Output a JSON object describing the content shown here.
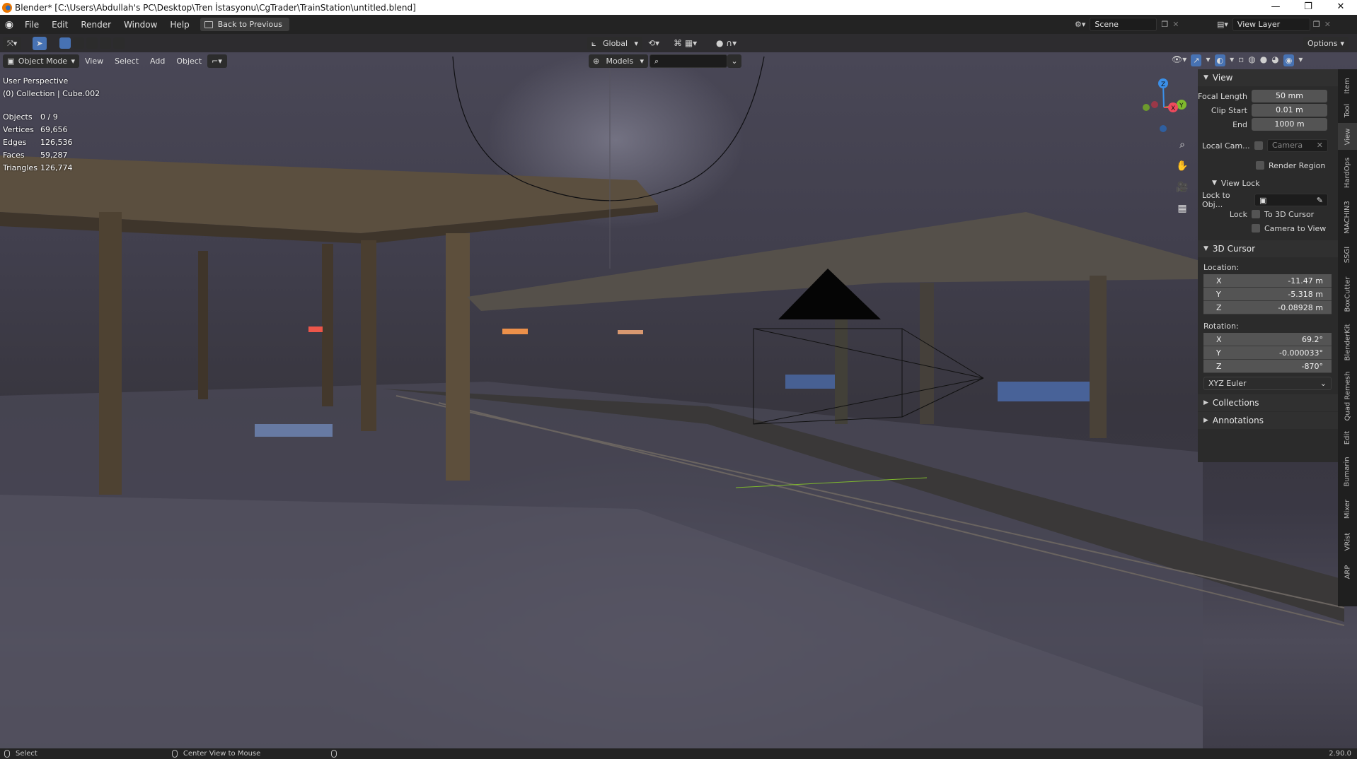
{
  "window": {
    "title": "Blender* [C:\\Users\\Abdullah's PC\\Desktop\\Tren İstasyonu\\CgTrader\\TrainStation\\untitled.blend]",
    "controls": [
      "—",
      "❐",
      "✕"
    ]
  },
  "topbar": {
    "menus": [
      "File",
      "Edit",
      "Render",
      "Window",
      "Help"
    ],
    "back_button": "Back to Previous",
    "scene": "Scene",
    "view_layer": "View Layer"
  },
  "tool_header": {
    "orientation": "Global",
    "options": "Options"
  },
  "mode_header": {
    "mode": "Object Mode",
    "menus": [
      "View",
      "Select",
      "Add",
      "Object"
    ],
    "collection_filter": "Models"
  },
  "viewport_info": {
    "perspective": "User Perspective",
    "collection": "(0) Collection | Cube.002",
    "stats": [
      {
        "label": "Objects",
        "value": "0 / 9"
      },
      {
        "label": "Vertices",
        "value": "69,656"
      },
      {
        "label": "Edges",
        "value": "126,536"
      },
      {
        "label": "Faces",
        "value": "59,287"
      },
      {
        "label": "Triangles",
        "value": "126,774"
      }
    ]
  },
  "gizmo": {
    "axes": [
      "X",
      "Y",
      "Z"
    ],
    "colors": {
      "x": "#ee4a5d",
      "y": "#7fb92d",
      "z": "#3b8fe8"
    }
  },
  "npanel": {
    "view": {
      "header": "View",
      "focal_length_label": "Focal Length",
      "focal_length": "50 mm",
      "clip_start_label": "Clip Start",
      "clip_start": "0.01 m",
      "end_label": "End",
      "end": "1000 m",
      "local_camera_label": "Local Cam...",
      "camera_placeholder": "Camera",
      "render_region": "Render Region",
      "view_lock_header": "View Lock",
      "lock_to_obj_label": "Lock to Obj...",
      "lock_label": "Lock",
      "to_3d_cursor": "To 3D Cursor",
      "camera_to_view": "Camera to View"
    },
    "cursor": {
      "header": "3D Cursor",
      "location_label": "Location:",
      "location": [
        {
          "axis": "X",
          "value": "-11.47 m"
        },
        {
          "axis": "Y",
          "value": "-5.318 m"
        },
        {
          "axis": "Z",
          "value": "-0.08928 m"
        }
      ],
      "rotation_label": "Rotation:",
      "rotation": [
        {
          "axis": "X",
          "value": "69.2°"
        },
        {
          "axis": "Y",
          "value": "-0.000033°"
        },
        {
          "axis": "Z",
          "value": "-870°"
        }
      ],
      "rotation_mode": "XYZ Euler"
    },
    "collections_header": "Collections",
    "annotations_header": "Annotations"
  },
  "sidebar_tabs": [
    "Item",
    "Tool",
    "View",
    "HardOps",
    "MACHIN3",
    "SSGI",
    "BoxCutter",
    "BlenderKit",
    "Quad Remesh",
    "Edit",
    "Bumarin",
    "Mixer",
    "VRist",
    "ARP"
  ],
  "statusbar": {
    "left": "Select",
    "middle": "Center View to Mouse",
    "version": "2.90.0"
  }
}
